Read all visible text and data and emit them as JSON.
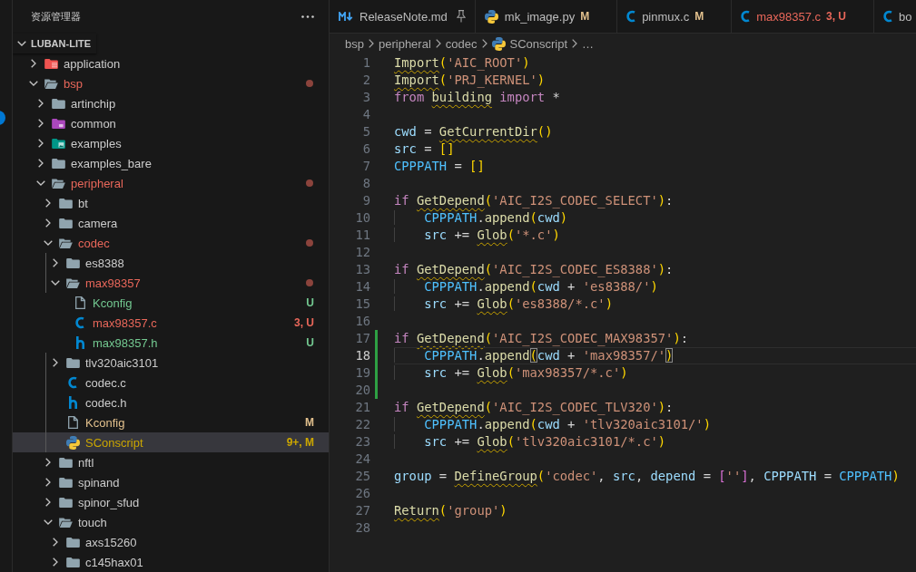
{
  "sidebar": {
    "title": "资源管理器",
    "section": {
      "title": "LUBAN-LITE",
      "expanded": true
    },
    "tree": [
      {
        "label": "application",
        "kind": "app-folder",
        "expanded": false,
        "selected": false
      },
      {
        "label": "bsp",
        "kind": "folder",
        "expanded": true,
        "selected": false,
        "color": "#e9675a",
        "children": [
          {
            "label": "artinchip",
            "kind": "folder",
            "expanded": false,
            "selected": false
          },
          {
            "label": "common",
            "kind": "common-folder",
            "expanded": false,
            "selected": false
          },
          {
            "label": "examples",
            "kind": "examples-folder",
            "expanded": false,
            "selected": false
          },
          {
            "label": "examples_bare",
            "kind": "folder",
            "expanded": false,
            "selected": false
          },
          {
            "label": "peripheral",
            "kind": "folder",
            "expanded": true,
            "selected": false,
            "color": "#e9675a",
            "children": [
              {
                "label": "bt",
                "kind": "folder",
                "expanded": false,
                "selected": false
              },
              {
                "label": "camera",
                "kind": "folder",
                "expanded": false,
                "selected": false
              },
              {
                "label": "codec",
                "kind": "folder",
                "expanded": true,
                "selected": false,
                "color": "#e9675a",
                "children": [
                  {
                    "label": "es8388",
                    "kind": "folder",
                    "expanded": false,
                    "selected": false
                  },
                  {
                    "label": "max98357",
                    "kind": "folder",
                    "expanded": true,
                    "selected": false,
                    "color": "#e9675a",
                    "children": [
                      {
                        "label": "Kconfig",
                        "kind": "text-file",
                        "selected": false,
                        "color": "#73c991",
                        "badge": "U"
                      },
                      {
                        "label": "max98357.c",
                        "kind": "c-file",
                        "selected": false,
                        "color": "#e9675a",
                        "badge": "3, U"
                      },
                      {
                        "label": "max98357.h",
                        "kind": "header-file",
                        "selected": false,
                        "color": "#73c991",
                        "badge": "U"
                      }
                    ]
                  },
                  {
                    "label": "tlv320aic3101",
                    "kind": "folder",
                    "expanded": false,
                    "selected": false
                  },
                  {
                    "label": "codec.c",
                    "kind": "c-file",
                    "selected": false
                  },
                  {
                    "label": "codec.h",
                    "kind": "header-file",
                    "selected": false
                  },
                  {
                    "label": "Kconfig",
                    "kind": "text-file",
                    "selected": false,
                    "color": "#e2c08d",
                    "badge": "M"
                  },
                  {
                    "label": "SConscript",
                    "kind": "python-file",
                    "selected": true,
                    "color": "#cca700",
                    "badge": "9+, M"
                  }
                ]
              },
              {
                "label": "nftl",
                "kind": "folder",
                "expanded": false,
                "selected": false
              },
              {
                "label": "spinand",
                "kind": "folder",
                "expanded": false,
                "selected": false
              },
              {
                "label": "spinor_sfud",
                "kind": "folder",
                "expanded": false,
                "selected": false
              },
              {
                "label": "touch",
                "kind": "folder",
                "expanded": true,
                "selected": false,
                "children": [
                  {
                    "label": "axs15260",
                    "kind": "folder",
                    "expanded": false,
                    "selected": false
                  },
                  {
                    "label": "c145hax01",
                    "kind": "folder",
                    "expanded": false,
                    "selected": false
                  }
                ]
              }
            ]
          }
        ]
      }
    ]
  },
  "editor": {
    "tabs": [
      {
        "label": "ReleaseNote.md",
        "kind": "markdown",
        "pinned": true,
        "errors": false,
        "selected": false
      },
      {
        "label": "mk_image.py",
        "kind": "python",
        "pinned": false,
        "errors": false,
        "selected": false,
        "color": "#e2c08d",
        "badge": "M"
      },
      {
        "label": "pinmux.c",
        "kind": "c",
        "pinned": false,
        "errors": false,
        "selected": false,
        "color": "#e2c08d",
        "badge": "M"
      },
      {
        "label": "max98357.c",
        "kind": "c",
        "pinned": false,
        "errors": true,
        "selected": false,
        "color": "#e9675a",
        "badge": "3, U"
      },
      {
        "label": "bo",
        "kind": "c",
        "pinned": false,
        "errors": false,
        "selected": false
      }
    ],
    "breadcrumb": [
      {
        "label": "bsp"
      },
      {
        "label": "peripheral"
      },
      {
        "label": "codec"
      },
      {
        "label": "SConscript",
        "kind": "python-file"
      },
      {
        "label": "…"
      }
    ],
    "lines": [
      {
        "number": "1",
        "added": false,
        "current": false,
        "tokens": [
          {
            "kind": "unresolved",
            "text": "Import"
          },
          {
            "kind": "bracket",
            "text": "("
          },
          {
            "kind": "string",
            "text": "'AIC_ROOT'"
          },
          {
            "kind": "bracket",
            "text": ")"
          }
        ]
      },
      {
        "number": "2",
        "added": false,
        "current": false,
        "tokens": [
          {
            "kind": "unresolved",
            "text": "Import"
          },
          {
            "kind": "bracket",
            "text": "("
          },
          {
            "kind": "string",
            "text": "'PRJ_KERNEL'"
          },
          {
            "kind": "bracket",
            "text": ")"
          }
        ]
      },
      {
        "number": "3",
        "added": false,
        "current": false,
        "tokens": [
          {
            "kind": "keyword",
            "text": "from"
          },
          {
            "kind": "unresolved",
            "text": " building"
          },
          {
            "kind": "keyword",
            "text": " import"
          },
          {
            "kind": "plain",
            "text": " *"
          }
        ]
      },
      {
        "number": "4",
        "added": false,
        "current": false
      },
      {
        "number": "5",
        "added": false,
        "current": false,
        "tokens": [
          {
            "kind": "variable",
            "text": "cwd"
          },
          {
            "kind": "plain",
            "text": " = "
          },
          {
            "kind": "unresolved",
            "text": "GetCurrentDir"
          },
          {
            "kind": "bracket",
            "text": "()"
          }
        ]
      },
      {
        "number": "6",
        "added": false,
        "current": false,
        "tokens": [
          {
            "kind": "variable",
            "text": "src"
          },
          {
            "kind": "plain",
            "text": " = "
          },
          {
            "kind": "bracket",
            "text": "[]"
          }
        ]
      },
      {
        "number": "7",
        "added": false,
        "current": false,
        "tokens": [
          {
            "kind": "constant",
            "text": "CPPPATH"
          },
          {
            "kind": "plain",
            "text": " = "
          },
          {
            "kind": "bracket",
            "text": "[]"
          }
        ]
      },
      {
        "number": "8",
        "added": false,
        "current": false
      },
      {
        "number": "9",
        "added": false,
        "current": false,
        "tokens": [
          {
            "kind": "keyword",
            "text": "if"
          },
          {
            "kind": "unresolved",
            "text": " GetDepend"
          },
          {
            "kind": "bracket",
            "text": "("
          },
          {
            "kind": "string",
            "text": "'AIC_I2S_CODEC_SELECT'"
          },
          {
            "kind": "bracket",
            "text": ")"
          },
          {
            "kind": "plain",
            "text": ":"
          }
        ]
      },
      {
        "number": "10",
        "added": false,
        "current": false,
        "tokens": [
          {
            "kind": "constant",
            "text": "    CPPPATH"
          },
          {
            "kind": "plain",
            "text": "."
          },
          {
            "kind": "function",
            "text": "append"
          },
          {
            "kind": "bracket",
            "text": "("
          },
          {
            "kind": "variable",
            "text": "cwd"
          },
          {
            "kind": "bracket",
            "text": ")"
          }
        ]
      },
      {
        "number": "11",
        "added": false,
        "current": false,
        "tokens": [
          {
            "kind": "variable",
            "text": "    src"
          },
          {
            "kind": "plain",
            "text": " += "
          },
          {
            "kind": "unresolved",
            "text": "Glob"
          },
          {
            "kind": "bracket",
            "text": "("
          },
          {
            "kind": "string",
            "text": "'*.c'"
          },
          {
            "kind": "bracket",
            "text": ")"
          }
        ]
      },
      {
        "number": "12",
        "added": false,
        "current": false
      },
      {
        "number": "13",
        "added": false,
        "current": false,
        "tokens": [
          {
            "kind": "keyword",
            "text": "if"
          },
          {
            "kind": "unresolved",
            "text": " GetDepend"
          },
          {
            "kind": "bracket",
            "text": "("
          },
          {
            "kind": "string",
            "text": "'AIC_I2S_CODEC_ES8388'"
          },
          {
            "kind": "bracket",
            "text": ")"
          },
          {
            "kind": "plain",
            "text": ":"
          }
        ]
      },
      {
        "number": "14",
        "added": false,
        "current": false,
        "tokens": [
          {
            "kind": "constant",
            "text": "    CPPPATH"
          },
          {
            "kind": "plain",
            "text": "."
          },
          {
            "kind": "function",
            "text": "append"
          },
          {
            "kind": "bracket",
            "text": "("
          },
          {
            "kind": "variable",
            "text": "cwd"
          },
          {
            "kind": "plain",
            "text": " + "
          },
          {
            "kind": "string",
            "text": "'es8388/'"
          },
          {
            "kind": "bracket",
            "text": ")"
          }
        ]
      },
      {
        "number": "15",
        "added": false,
        "current": false,
        "tokens": [
          {
            "kind": "variable",
            "text": "    src"
          },
          {
            "kind": "plain",
            "text": " += "
          },
          {
            "kind": "unresolved",
            "text": "Glob"
          },
          {
            "kind": "bracket",
            "text": "("
          },
          {
            "kind": "string",
            "text": "'es8388/*.c'"
          },
          {
            "kind": "bracket",
            "text": ")"
          }
        ]
      },
      {
        "number": "16",
        "added": false,
        "current": false
      },
      {
        "number": "17",
        "added": true,
        "current": false,
        "tokens": [
          {
            "kind": "keyword",
            "text": "if"
          },
          {
            "kind": "unresolved",
            "text": " GetDepend"
          },
          {
            "kind": "bracket",
            "text": "("
          },
          {
            "kind": "string",
            "text": "'AIC_I2S_CODEC_MAX98357'"
          },
          {
            "kind": "bracket",
            "text": ")"
          },
          {
            "kind": "plain",
            "text": ":"
          }
        ]
      },
      {
        "number": "18",
        "added": true,
        "current": true,
        "tokens": [
          {
            "kind": "constant",
            "text": "    CPPPATH"
          },
          {
            "kind": "plain",
            "text": "."
          },
          {
            "kind": "function",
            "text": "append"
          },
          {
            "kind": "matched-bracket",
            "text": "("
          },
          {
            "kind": "variable",
            "text": "cwd"
          },
          {
            "kind": "plain",
            "text": " + "
          },
          {
            "kind": "string",
            "text": "'max98357/'"
          },
          {
            "kind": "matched-bracket",
            "text": ")"
          }
        ]
      },
      {
        "number": "19",
        "added": true,
        "current": false,
        "tokens": [
          {
            "kind": "variable",
            "text": "    src"
          },
          {
            "kind": "plain",
            "text": " += "
          },
          {
            "kind": "unresolved",
            "text": "Glob"
          },
          {
            "kind": "bracket",
            "text": "("
          },
          {
            "kind": "string",
            "text": "'max98357/*.c'"
          },
          {
            "kind": "bracket",
            "text": ")"
          }
        ]
      },
      {
        "number": "20",
        "added": true,
        "current": false
      },
      {
        "number": "21",
        "added": false,
        "current": false,
        "tokens": [
          {
            "kind": "keyword",
            "text": "if"
          },
          {
            "kind": "unresolved",
            "text": " GetDepend"
          },
          {
            "kind": "bracket",
            "text": "("
          },
          {
            "kind": "string",
            "text": "'AIC_I2S_CODEC_TLV320'"
          },
          {
            "kind": "bracket",
            "text": ")"
          },
          {
            "kind": "plain",
            "text": ":"
          }
        ]
      },
      {
        "number": "22",
        "added": false,
        "current": false,
        "tokens": [
          {
            "kind": "constant",
            "text": "    CPPPATH"
          },
          {
            "kind": "plain",
            "text": "."
          },
          {
            "kind": "function",
            "text": "append"
          },
          {
            "kind": "bracket",
            "text": "("
          },
          {
            "kind": "variable",
            "text": "cwd"
          },
          {
            "kind": "plain",
            "text": " + "
          },
          {
            "kind": "string",
            "text": "'tlv320aic3101/'"
          },
          {
            "kind": "bracket",
            "text": ")"
          }
        ]
      },
      {
        "number": "23",
        "added": false,
        "current": false,
        "tokens": [
          {
            "kind": "variable",
            "text": "    src"
          },
          {
            "kind": "plain",
            "text": " += "
          },
          {
            "kind": "unresolved",
            "text": "Glob"
          },
          {
            "kind": "bracket",
            "text": "("
          },
          {
            "kind": "string",
            "text": "'tlv320aic3101/*.c'"
          },
          {
            "kind": "bracket",
            "text": ")"
          }
        ]
      },
      {
        "number": "24",
        "added": false,
        "current": false
      },
      {
        "number": "25",
        "added": false,
        "current": false,
        "tokens": [
          {
            "kind": "variable",
            "text": "group"
          },
          {
            "kind": "plain",
            "text": " = "
          },
          {
            "kind": "unresolved",
            "text": "DefineGroup"
          },
          {
            "kind": "bracket",
            "text": "("
          },
          {
            "kind": "string",
            "text": "'codec'"
          },
          {
            "kind": "plain",
            "text": ", "
          },
          {
            "kind": "variable",
            "text": "src"
          },
          {
            "kind": "plain",
            "text": ", "
          },
          {
            "kind": "variable",
            "text": "depend"
          },
          {
            "kind": "plain",
            "text": " = "
          },
          {
            "kind": "bracket2",
            "text": "["
          },
          {
            "kind": "string",
            "text": "''"
          },
          {
            "kind": "bracket2",
            "text": "]"
          },
          {
            "kind": "plain",
            "text": ", "
          },
          {
            "kind": "variable",
            "text": "CPPPATH"
          },
          {
            "kind": "plain",
            "text": " = "
          },
          {
            "kind": "constant",
            "text": "CPPPATH"
          },
          {
            "kind": "bracket",
            "text": ")"
          }
        ]
      },
      {
        "number": "26",
        "added": false,
        "current": false
      },
      {
        "number": "27",
        "added": false,
        "current": false,
        "tokens": [
          {
            "kind": "unresolved",
            "text": "Return"
          },
          {
            "kind": "bracket",
            "text": "("
          },
          {
            "kind": "string",
            "text": "'group'"
          },
          {
            "kind": "bracket",
            "text": ")"
          }
        ]
      },
      {
        "number": "28",
        "added": false,
        "current": false
      }
    ]
  }
}
